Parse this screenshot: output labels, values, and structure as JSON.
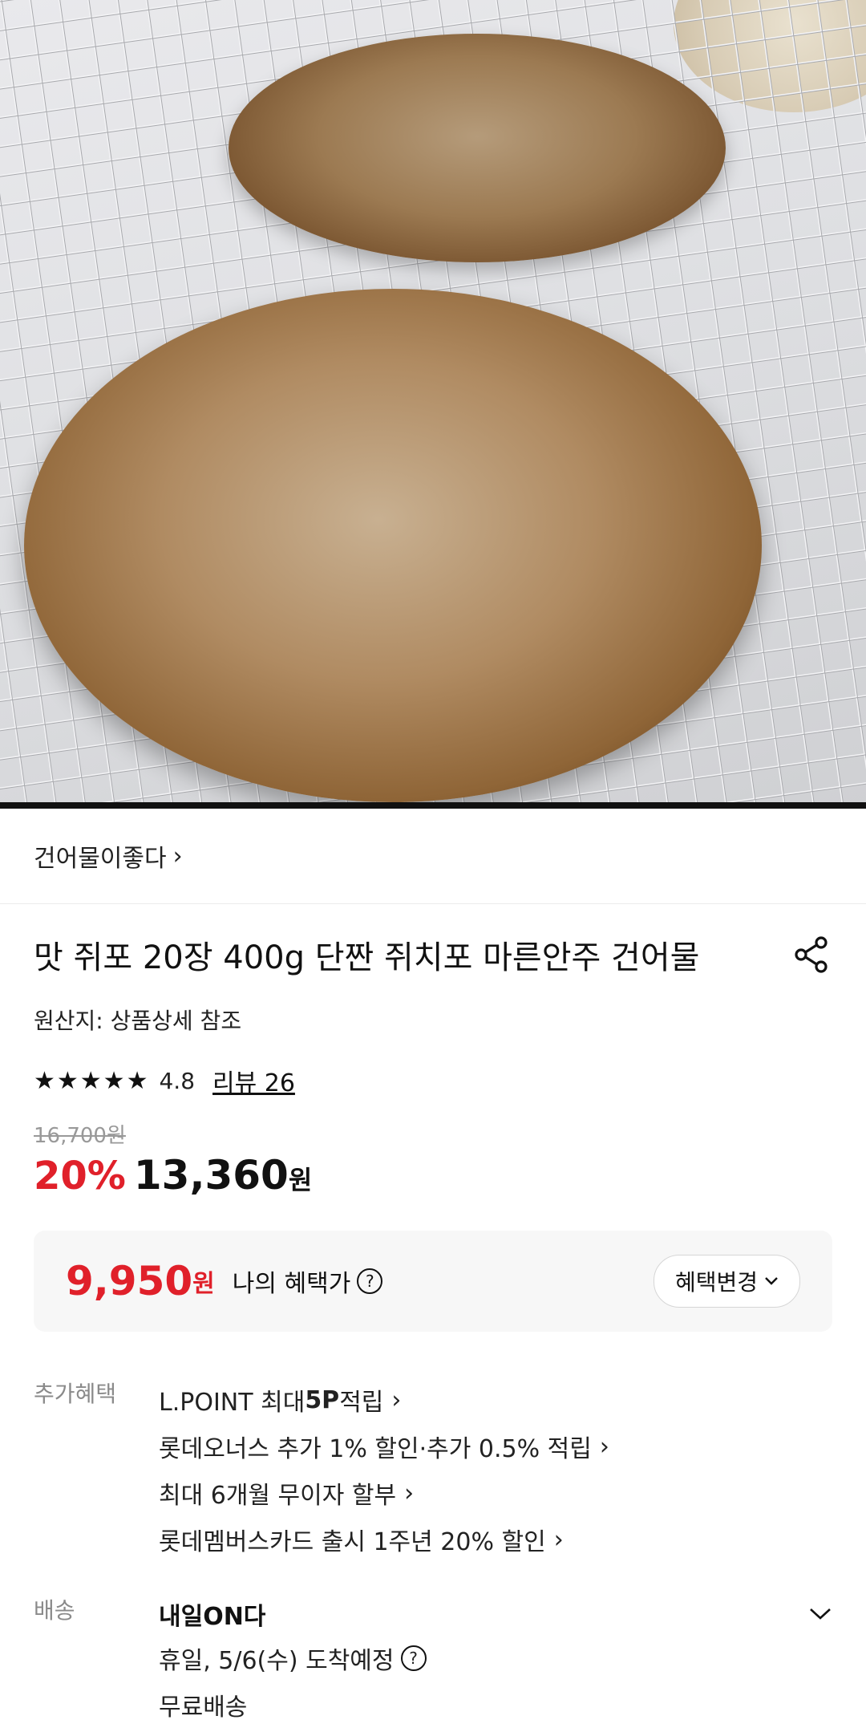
{
  "hero": {
    "image_desc": "photo-product",
    "progress_fraction": 1.0
  },
  "seller": {
    "name": "건어물이좋다",
    "chevron": "›"
  },
  "product": {
    "title": "맛 쥐포 20장 400g 단짠 쥐치포 마른안주 건어물",
    "origin": "원산지: 상품상세 참조",
    "stars": "★★★★★",
    "rating": "4.8",
    "review_label": "리뷰 26",
    "original_price": "16,700원",
    "discount": "20%",
    "sale_price": "13,360",
    "sale_currency": "원"
  },
  "benefit_box": {
    "my_price": "9,950",
    "my_price_currency": "원",
    "label": "나의 혜택가",
    "help": "?",
    "change_button": "혜택변경"
  },
  "extra_benefits": {
    "label": "추가혜택",
    "items": [
      {
        "text": "L.POINT 최대 ",
        "bold": "5P",
        "after": " 적립"
      },
      {
        "text": "롯데오너스 추가 1% 할인·추가 0.5% 적립",
        "bold": "",
        "after": ""
      },
      {
        "text": "최대 6개월 무이자 할부",
        "bold": "",
        "after": ""
      },
      {
        "text": "롯데멤버스카드 출시 1주년 20% 할인",
        "bold": "",
        "after": ""
      }
    ]
  },
  "delivery": {
    "label": "배송",
    "type": "내일ON다",
    "arrival": "휴일, 5/6(수) 도착예정",
    "help": "?",
    "fee": "무료배송"
  },
  "colors": {
    "accent_red": "#e0202a",
    "muted_gray": "#8a8a8a"
  },
  "icons": {
    "share": "share-icon",
    "help": "help-circle-icon",
    "chevron": "chevron-right-icon",
    "expand": "chevron-down-icon"
  }
}
